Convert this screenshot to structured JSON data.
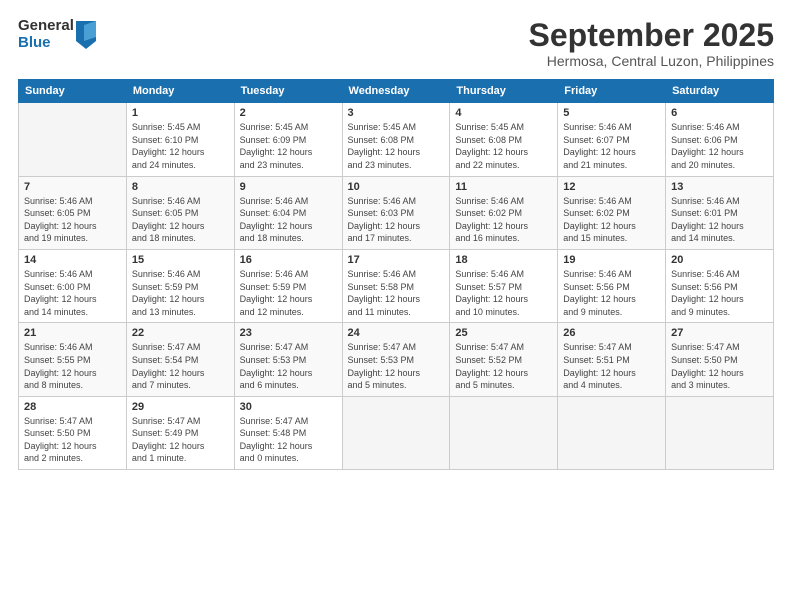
{
  "logo": {
    "general": "General",
    "blue": "Blue"
  },
  "title": "September 2025",
  "location": "Hermosa, Central Luzon, Philippines",
  "weekdays": [
    "Sunday",
    "Monday",
    "Tuesday",
    "Wednesday",
    "Thursday",
    "Friday",
    "Saturday"
  ],
  "weeks": [
    [
      {
        "day": "",
        "info": ""
      },
      {
        "day": "1",
        "info": "Sunrise: 5:45 AM\nSunset: 6:10 PM\nDaylight: 12 hours\nand 24 minutes."
      },
      {
        "day": "2",
        "info": "Sunrise: 5:45 AM\nSunset: 6:09 PM\nDaylight: 12 hours\nand 23 minutes."
      },
      {
        "day": "3",
        "info": "Sunrise: 5:45 AM\nSunset: 6:08 PM\nDaylight: 12 hours\nand 23 minutes."
      },
      {
        "day": "4",
        "info": "Sunrise: 5:45 AM\nSunset: 6:08 PM\nDaylight: 12 hours\nand 22 minutes."
      },
      {
        "day": "5",
        "info": "Sunrise: 5:46 AM\nSunset: 6:07 PM\nDaylight: 12 hours\nand 21 minutes."
      },
      {
        "day": "6",
        "info": "Sunrise: 5:46 AM\nSunset: 6:06 PM\nDaylight: 12 hours\nand 20 minutes."
      }
    ],
    [
      {
        "day": "7",
        "info": "Sunrise: 5:46 AM\nSunset: 6:05 PM\nDaylight: 12 hours\nand 19 minutes."
      },
      {
        "day": "8",
        "info": "Sunrise: 5:46 AM\nSunset: 6:05 PM\nDaylight: 12 hours\nand 18 minutes."
      },
      {
        "day": "9",
        "info": "Sunrise: 5:46 AM\nSunset: 6:04 PM\nDaylight: 12 hours\nand 18 minutes."
      },
      {
        "day": "10",
        "info": "Sunrise: 5:46 AM\nSunset: 6:03 PM\nDaylight: 12 hours\nand 17 minutes."
      },
      {
        "day": "11",
        "info": "Sunrise: 5:46 AM\nSunset: 6:02 PM\nDaylight: 12 hours\nand 16 minutes."
      },
      {
        "day": "12",
        "info": "Sunrise: 5:46 AM\nSunset: 6:02 PM\nDaylight: 12 hours\nand 15 minutes."
      },
      {
        "day": "13",
        "info": "Sunrise: 5:46 AM\nSunset: 6:01 PM\nDaylight: 12 hours\nand 14 minutes."
      }
    ],
    [
      {
        "day": "14",
        "info": "Sunrise: 5:46 AM\nSunset: 6:00 PM\nDaylight: 12 hours\nand 14 minutes."
      },
      {
        "day": "15",
        "info": "Sunrise: 5:46 AM\nSunset: 5:59 PM\nDaylight: 12 hours\nand 13 minutes."
      },
      {
        "day": "16",
        "info": "Sunrise: 5:46 AM\nSunset: 5:59 PM\nDaylight: 12 hours\nand 12 minutes."
      },
      {
        "day": "17",
        "info": "Sunrise: 5:46 AM\nSunset: 5:58 PM\nDaylight: 12 hours\nand 11 minutes."
      },
      {
        "day": "18",
        "info": "Sunrise: 5:46 AM\nSunset: 5:57 PM\nDaylight: 12 hours\nand 10 minutes."
      },
      {
        "day": "19",
        "info": "Sunrise: 5:46 AM\nSunset: 5:56 PM\nDaylight: 12 hours\nand 9 minutes."
      },
      {
        "day": "20",
        "info": "Sunrise: 5:46 AM\nSunset: 5:56 PM\nDaylight: 12 hours\nand 9 minutes."
      }
    ],
    [
      {
        "day": "21",
        "info": "Sunrise: 5:46 AM\nSunset: 5:55 PM\nDaylight: 12 hours\nand 8 minutes."
      },
      {
        "day": "22",
        "info": "Sunrise: 5:47 AM\nSunset: 5:54 PM\nDaylight: 12 hours\nand 7 minutes."
      },
      {
        "day": "23",
        "info": "Sunrise: 5:47 AM\nSunset: 5:53 PM\nDaylight: 12 hours\nand 6 minutes."
      },
      {
        "day": "24",
        "info": "Sunrise: 5:47 AM\nSunset: 5:53 PM\nDaylight: 12 hours\nand 5 minutes."
      },
      {
        "day": "25",
        "info": "Sunrise: 5:47 AM\nSunset: 5:52 PM\nDaylight: 12 hours\nand 5 minutes."
      },
      {
        "day": "26",
        "info": "Sunrise: 5:47 AM\nSunset: 5:51 PM\nDaylight: 12 hours\nand 4 minutes."
      },
      {
        "day": "27",
        "info": "Sunrise: 5:47 AM\nSunset: 5:50 PM\nDaylight: 12 hours\nand 3 minutes."
      }
    ],
    [
      {
        "day": "28",
        "info": "Sunrise: 5:47 AM\nSunset: 5:50 PM\nDaylight: 12 hours\nand 2 minutes."
      },
      {
        "day": "29",
        "info": "Sunrise: 5:47 AM\nSunset: 5:49 PM\nDaylight: 12 hours\nand 1 minute."
      },
      {
        "day": "30",
        "info": "Sunrise: 5:47 AM\nSunset: 5:48 PM\nDaylight: 12 hours\nand 0 minutes."
      },
      {
        "day": "",
        "info": ""
      },
      {
        "day": "",
        "info": ""
      },
      {
        "day": "",
        "info": ""
      },
      {
        "day": "",
        "info": ""
      }
    ]
  ]
}
